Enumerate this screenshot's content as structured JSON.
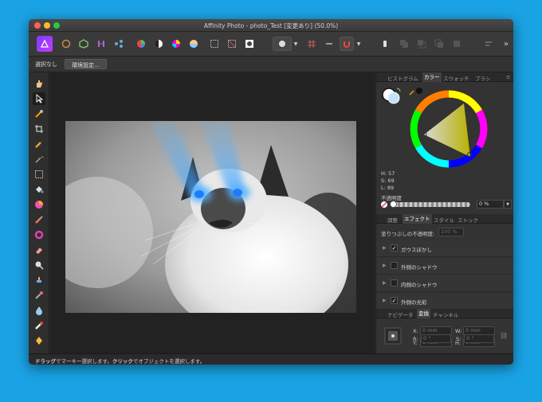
{
  "window": {
    "title": "Affinity Photo - photo_Test [変更あり] (50.0%)"
  },
  "context_toolbar": {
    "selection_label": "選択なし",
    "preferences_button": "環境設定..."
  },
  "panels": {
    "top_tabs": [
      "ヒストグラム",
      "カラー",
      "スウォッチ",
      "ブラシ"
    ],
    "top_active": "カラー",
    "color": {
      "h": "H: 57",
      "s": "S: 69",
      "l": "L: 89",
      "opacity_label": "不透明度",
      "opacity_value": "0 %"
    },
    "mid_tabs": [
      "調整",
      "エフェクト",
      "スタイル",
      "ストック"
    ],
    "mid_active": "エフェクト",
    "fill_opacity_label": "塗りつぶしの不透明度:",
    "fill_opacity_value": "100 %",
    "effects": [
      {
        "label": "ガウスぼかし",
        "checked": true
      },
      {
        "label": "外側のシャドウ",
        "checked": false
      },
      {
        "label": "内側のシャドウ",
        "checked": false
      },
      {
        "label": "外側の光彩",
        "checked": true
      }
    ],
    "bottom_tabs": [
      "ナビゲータ",
      "変換",
      "チャンネル"
    ],
    "bottom_active": "変換",
    "transform": {
      "x_label": "X:",
      "x_value": "0 mm",
      "y_label": "Y:",
      "y_value": "0 mm",
      "w_label": "W:",
      "w_value": "0 mm",
      "h_label": "H:",
      "h_value": "0 mm",
      "r_label": "R:",
      "r_value": "0 °",
      "s_label": "S:",
      "s_value": "0 °"
    }
  },
  "status": {
    "drag": "ドラッグ",
    "drag_text": "でマーキー選択します。",
    "click": "クリック",
    "click_text": "でオブジェクトを選択します。"
  },
  "colors": {
    "desktop": "#1aa3e4",
    "accent_blue": "#3aa0ff",
    "selected_color": "#e3de6a"
  }
}
